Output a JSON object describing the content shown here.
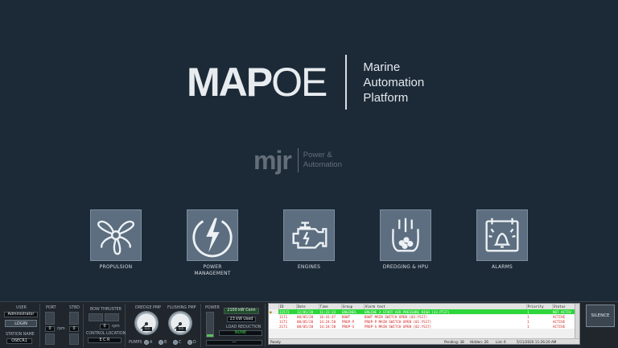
{
  "brand": {
    "word_bold": "MAP",
    "word_light": "OE",
    "subtitle": [
      "Marine",
      "Automation",
      "Platform"
    ]
  },
  "sub_brand": {
    "word": "mjr",
    "text": [
      "Power &",
      "Automation"
    ]
  },
  "tiles": [
    {
      "label": "PROPULSION",
      "icon": "propeller-icon"
    },
    {
      "label": "POWER\nMANAGEMENT",
      "icon": "lightning-icon"
    },
    {
      "label": "ENGINES",
      "icon": "engine-icon"
    },
    {
      "label": "DREDGING & HPU",
      "icon": "dredging-icon"
    },
    {
      "label": "ALARMS",
      "icon": "alarm-bell-icon"
    }
  ],
  "panel": {
    "user_label": "USER",
    "user_value": "Administrator",
    "login_label": "LOGIN",
    "station_label": "STATION NAME",
    "station_value": "OSECR1",
    "port_label": "PORT",
    "stbd_label": "STBD",
    "port_value": "0",
    "stbd_value": "0",
    "rpm_label": "rpm",
    "bow_label": "BOW THRUSTER",
    "bow_value": "0",
    "bow_rpm": "rpm",
    "control_label": "CONTROL LOCATION",
    "control_value": "E C R",
    "dredge_label": "DREDGE PMP",
    "flushing_label": "FLUSHING PMP",
    "dredge_gauge": "0.0",
    "flushing_gauge": "0.0",
    "pumps_label": "PUMPS",
    "pumps": [
      "A",
      "B",
      "C",
      "D"
    ],
    "power_label": "POWER",
    "power_conn": "2100 kW Conn",
    "power_used": "23 kW Used",
    "load_reduction_label": "LOAD REDUCTION",
    "load_reduction_value": "NONE",
    "dash_value": "---"
  },
  "alarm_list": {
    "columns": [
      "ID",
      "Date",
      "Time",
      "Group",
      "Alarm text",
      "Priority",
      "Status"
    ],
    "rows": [
      {
        "id": "I1572",
        "date": "12/05/20",
        "time": "11:22:23",
        "group": "ENGINES",
        "text": "ENGINE 3 START AIR PRESSURE HIGH (23.PT37)",
        "priority": "1",
        "status": "NOT ACTIV",
        "color": "green"
      },
      {
        "id": "1171",
        "date": "08/05/20",
        "time": "16:41:47",
        "group": "BOWT",
        "text": "BOWT MAIN SWITCH OPEN (03.YS17)",
        "priority": "1",
        "status": "ACTIVE",
        "color": "red"
      },
      {
        "id": "1171",
        "date": "08/05/20",
        "time": "14:24:58",
        "group": "PROP-P",
        "text": "PROP-P MAIN SWITCH OPEN (01.YS17)",
        "priority": "1",
        "status": "ACTIVE",
        "color": "red"
      },
      {
        "id": "2171",
        "date": "08/05/20",
        "time": "14:24:58",
        "group": "PROP-S",
        "text": "PROP-S MAIN SWITCH OPEN (02.YS17)",
        "priority": "1",
        "status": "ACTIVE",
        "color": "red"
      }
    ],
    "status_ready": "Ready",
    "pending": "Pending: 38",
    "hidden": "Hidden: 26",
    "list": "List: 6",
    "datetime": "5/11/2020  11:26:20 AM"
  },
  "silence_label": "SILENCE",
  "colors": {
    "background": "#1c2a38",
    "tile": "#5c6e80",
    "alarm_green": "#2dd63a",
    "alarm_red": "#d21d1d"
  }
}
